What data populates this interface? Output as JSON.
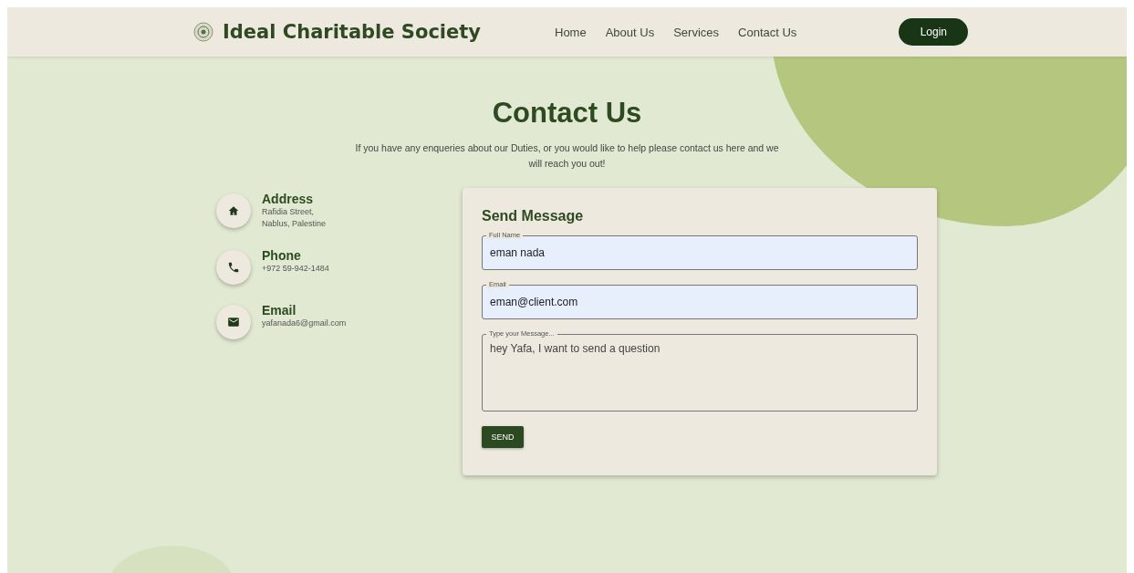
{
  "header": {
    "brand": "Ideal Charitable Society",
    "nav": [
      {
        "label": "Home",
        "selected": false
      },
      {
        "label": "About Us",
        "selected": false
      },
      {
        "label": "Services",
        "selected": false
      },
      {
        "label": "Contact Us",
        "selected": false
      }
    ],
    "login": "Login"
  },
  "title": "Contact Us",
  "intro": "If you have any enqueries about our Duties, or you would like to help please contact us here and we will reach you out!",
  "contacts": [
    {
      "kind": "address",
      "label": "Address",
      "lines": [
        "Rafidia Street,",
        "Nablus, Palestine"
      ]
    },
    {
      "kind": "phone",
      "label": "Phone",
      "lines": [
        "+972 59-942-1484"
      ]
    },
    {
      "kind": "email",
      "label": "Email",
      "lines": [
        "yafanada6@gmail.com"
      ]
    }
  ],
  "form": {
    "title": "Send Message",
    "fields": [
      {
        "kind": "input",
        "label": "Full Name",
        "value": "eman nada",
        "autofilled": true
      },
      {
        "kind": "input",
        "label": "Email",
        "value": "eman@client.com",
        "autofilled": true
      },
      {
        "kind": "textarea",
        "label": "Type your Message...",
        "value": "hey Yafa, I want to send a question",
        "autofilled": false
      }
    ],
    "button": "SEND"
  }
}
